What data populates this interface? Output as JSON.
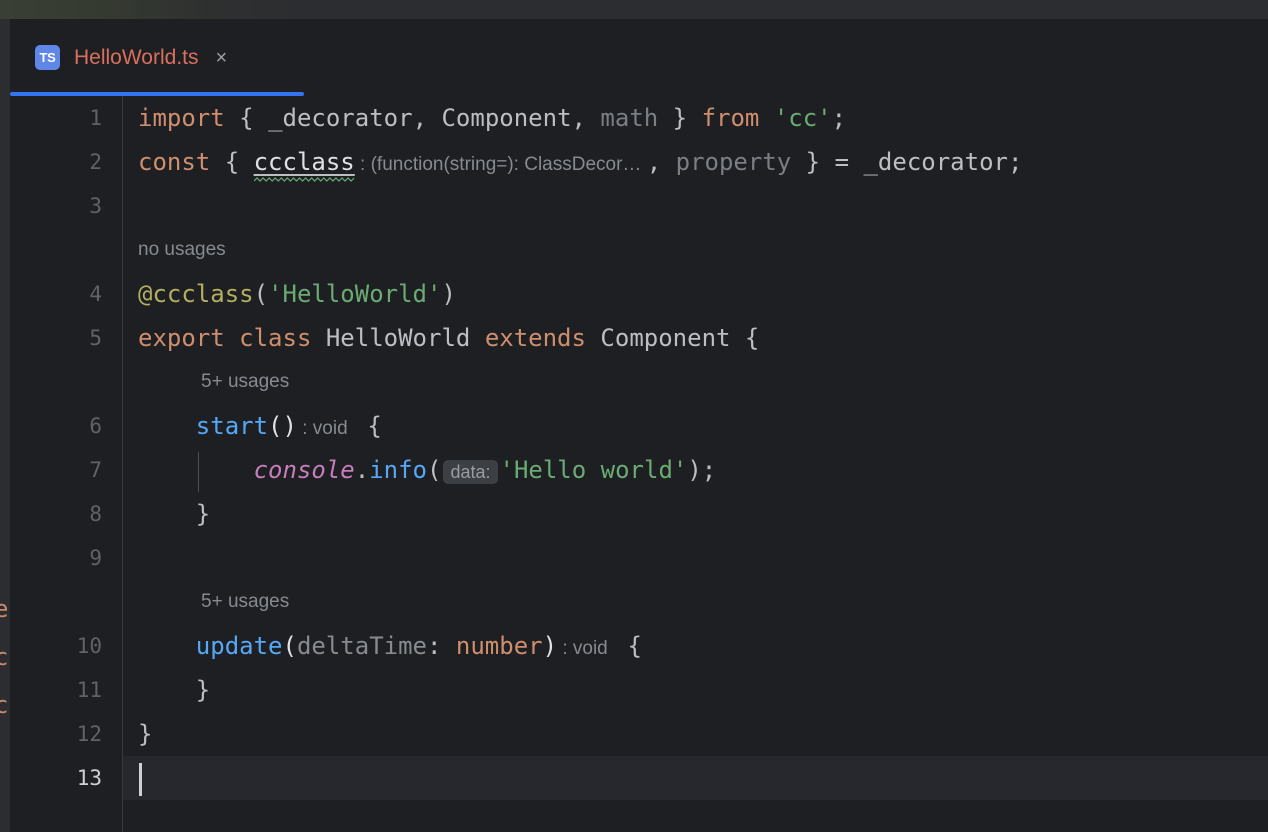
{
  "window": {
    "background": "#1e1f22",
    "accent": "#3574f0"
  },
  "tab": {
    "filetype_badge": "TS",
    "title": "HelloWorld.ts",
    "close_glyph": "×",
    "close_name": "close-tab-icon",
    "active": true,
    "underline_color": "#3574f0",
    "title_color": "#d9705e"
  },
  "editor": {
    "language": "TypeScript",
    "caret_line": 13,
    "line_numbers": [
      "1",
      "2",
      "3",
      "4",
      "5",
      "6",
      "7",
      "8",
      "9",
      "10",
      "11",
      "12",
      "13"
    ],
    "code_lines": [
      {
        "n": "1",
        "text": "import { _decorator, Component, math } from 'cc';"
      },
      {
        "n": "2",
        "text": "const { ccclass : (function(string=): ClassDecor… , property } = _decorator;"
      },
      {
        "n": "3",
        "text": ""
      },
      {
        "n": "4",
        "text": "@ccclass('HelloWorld')"
      },
      {
        "n": "5",
        "text": "export class HelloWorld extends Component {"
      },
      {
        "n": "6",
        "text": "    start() : void  {"
      },
      {
        "n": "7",
        "text": "        console.info( data: 'Hello world');"
      },
      {
        "n": "8",
        "text": "    }"
      },
      {
        "n": "9",
        "text": ""
      },
      {
        "n": "10",
        "text": "    update(deltaTime: number) : void  {"
      },
      {
        "n": "11",
        "text": "    }"
      },
      {
        "n": "12",
        "text": "}"
      },
      {
        "n": "13",
        "text": ""
      }
    ],
    "tokens": {
      "l1": {
        "import": "import",
        "brace_open": " { ",
        "decorator_import": "_decorator",
        "comma1": ", ",
        "component": "Component",
        "comma2": ", ",
        "math": "math",
        "brace_close": " } ",
        "from": "from",
        "space": " ",
        "module": "'cc'",
        "semi": ";"
      },
      "l2": {
        "const": "const",
        "brace_open": " { ",
        "ccclass": "ccclass",
        "type_hint": " : (function(string=): ClassDecor… ",
        "comma": ", ",
        "property": "property",
        "brace_close": " } ",
        "equals": "= ",
        "decorator": "_decorator",
        "semi": ";"
      },
      "l4": {
        "decorator": "@ccclass",
        "paren_open": "(",
        "arg": "'HelloWorld'",
        "paren_close": ")"
      },
      "l5": {
        "export": "export",
        "space1": " ",
        "class": "class",
        "space2": " ",
        "name": "HelloWorld",
        "space3": " ",
        "extends": "extends",
        "space4": " ",
        "base": "Component",
        "brace": " {"
      },
      "l6": {
        "indent": "    ",
        "name": "start",
        "parens": "()",
        "return_hint": " : void ",
        "brace": " {"
      },
      "l7": {
        "indent": "        ",
        "object": "console",
        "dot": ".",
        "method": "info",
        "paren_open": "(",
        "param_hint": "data:",
        "arg": "'Hello world'",
        "paren_close": ")",
        "semi": ";"
      },
      "l8": {
        "indent": "    ",
        "brace": "}"
      },
      "l10": {
        "indent": "    ",
        "name": "update",
        "paren_open": "(",
        "param": "deltaTime",
        "colon": ": ",
        "type": "number",
        "paren_close": ")",
        "return_hint": " : void ",
        "brace": " {"
      },
      "l11": {
        "indent": "    ",
        "brace": "}"
      },
      "l12": {
        "brace": "}"
      }
    },
    "inlay_hints": [
      {
        "id": "usages-line4",
        "text": "no usages",
        "for_line": "4"
      },
      {
        "id": "usages-line6",
        "text": "5+ usages",
        "for_line": "6"
      },
      {
        "id": "usages-line10",
        "text": "5+ usages",
        "for_line": "10"
      }
    ],
    "warning": {
      "symbol": "ccclass",
      "style": "green-wavy-underline",
      "color": "#6aab73"
    },
    "colors": {
      "keyword": "#cf8e6d",
      "string": "#6aab73",
      "decorator": "#b3ae60",
      "function": "#56a8f5",
      "object_italic": "#c77dbb",
      "default_text": "#bcbec4",
      "dimmed": "#7a7e85",
      "hint_text": "#868a91",
      "line_number": "#606366",
      "current_line_number": "#ced0d6",
      "current_line_bg": "#26282e",
      "gutter_divider": "#393b40"
    }
  },
  "left_rail": {
    "clipped_glyphs": [
      "e",
      "c",
      "c"
    ],
    "color": "#cf8e6d"
  }
}
